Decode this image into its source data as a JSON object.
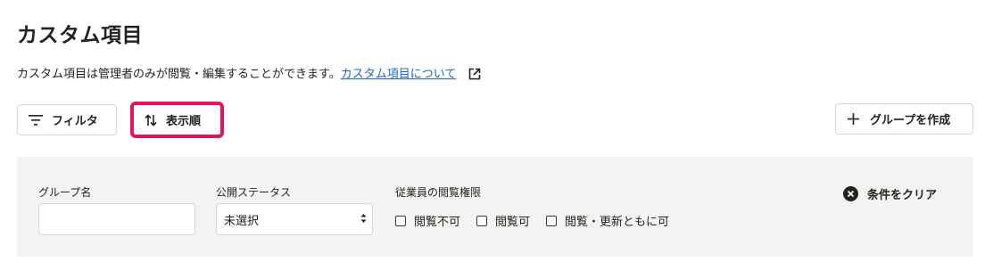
{
  "header": {
    "title": "カスタム項目"
  },
  "description": {
    "text": "カスタム項目は管理者のみが閲覧・編集することができます。",
    "link_label": "カスタム項目について"
  },
  "toolbar": {
    "filter_label": "フィルタ",
    "sort_label": "表示順",
    "create_group_label": "グループを作成"
  },
  "filters": {
    "group_name_label": "グループ名",
    "group_name_value": "",
    "status_label": "公開ステータス",
    "status_value": "未選択",
    "permission_label": "従業員の閲覧権限",
    "permission_options": [
      "閲覧不可",
      "閲覧可",
      "閲覧・更新ともに可"
    ],
    "clear_label": "条件をクリア"
  },
  "colors": {
    "highlight": "#e4135e",
    "link": "#1a67c7",
    "panel_bg": "#f4f3f2"
  },
  "icons": {
    "filter": "filter-icon",
    "sort": "sort-icon",
    "plus": "plus-icon",
    "external": "external-link-icon",
    "clear": "clear-circle-icon"
  }
}
